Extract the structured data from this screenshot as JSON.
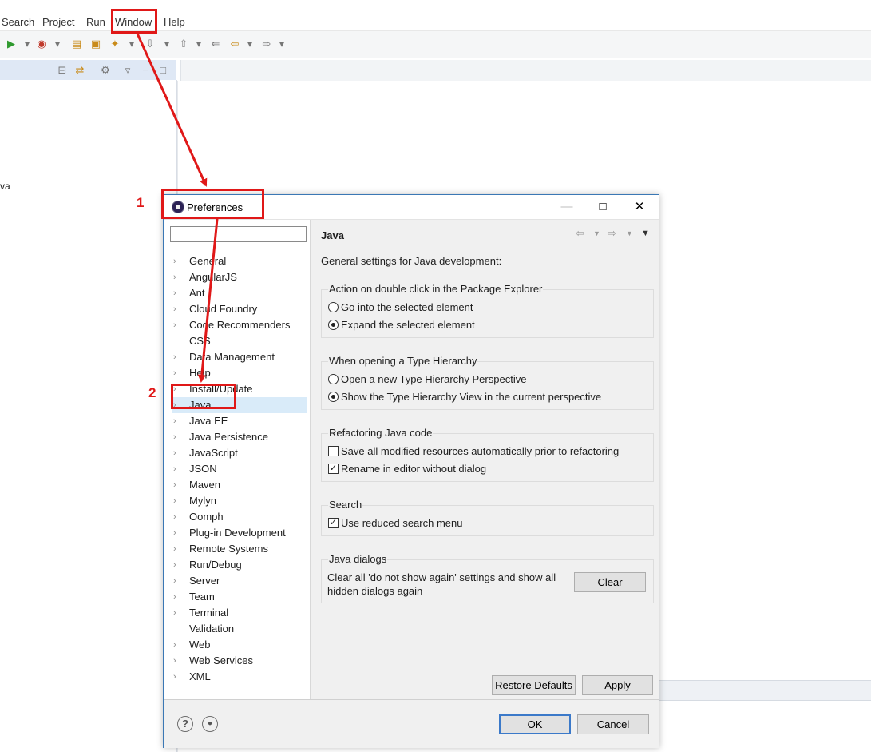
{
  "menubar": {
    "items": [
      "Search",
      "Project",
      "Run",
      "Window",
      "Help"
    ]
  },
  "left_view": {
    "truncated_item": "va"
  },
  "dialog": {
    "title": "Preferences",
    "filter_placeholder": "",
    "tree": [
      "General",
      "AngularJS",
      "Ant",
      "Cloud Foundry",
      "Code Recommenders",
      "CSS",
      "Data Management",
      "Help",
      "Install/Update",
      "Java",
      "Java EE",
      "Java Persistence",
      "JavaScript",
      "JSON",
      "Maven",
      "Mylyn",
      "Oomph",
      "Plug-in Development",
      "Remote Systems",
      "Run/Debug",
      "Server",
      "Team",
      "Terminal",
      "Validation",
      "Web",
      "Web Services",
      "XML"
    ],
    "tree_without_chevron": [
      "CSS",
      "Validation"
    ],
    "selected_item": "Java",
    "page": {
      "title": "Java",
      "description": "General settings for Java development:",
      "groups": {
        "double_click": {
          "title": "Action on double click in the Package Explorer",
          "opt1": "Go into the selected element",
          "opt2": "Expand the selected element",
          "selected": "opt2"
        },
        "type_hierarchy": {
          "title": "When opening a Type Hierarchy",
          "opt1": "Open a new Type Hierarchy Perspective",
          "opt2": "Show the Type Hierarchy View in the current perspective",
          "selected": "opt2"
        },
        "refactoring": {
          "title": "Refactoring Java code",
          "opt1": "Save all modified resources automatically prior to refactoring",
          "opt1_checked": false,
          "opt2": "Rename in editor without dialog",
          "opt2_checked": true
        },
        "search": {
          "title": "Search",
          "opt1": "Use reduced search menu",
          "opt1_checked": true
        },
        "dialogs": {
          "title": "Java dialogs",
          "text": "Clear all 'do not show again' settings and show all hidden dialogs again",
          "clear_label": "Clear"
        }
      },
      "restore_defaults": "Restore Defaults",
      "apply": "Apply"
    },
    "ok": "OK",
    "cancel": "Cancel",
    "help_glyph": "?"
  },
  "annotations": {
    "step1": "1",
    "step2": "2",
    "color": "#e01818"
  },
  "colors": {
    "selection": "#d9ebf9",
    "dialog_border": "#3b78b5",
    "primary_button_border": "#3b79c9"
  }
}
